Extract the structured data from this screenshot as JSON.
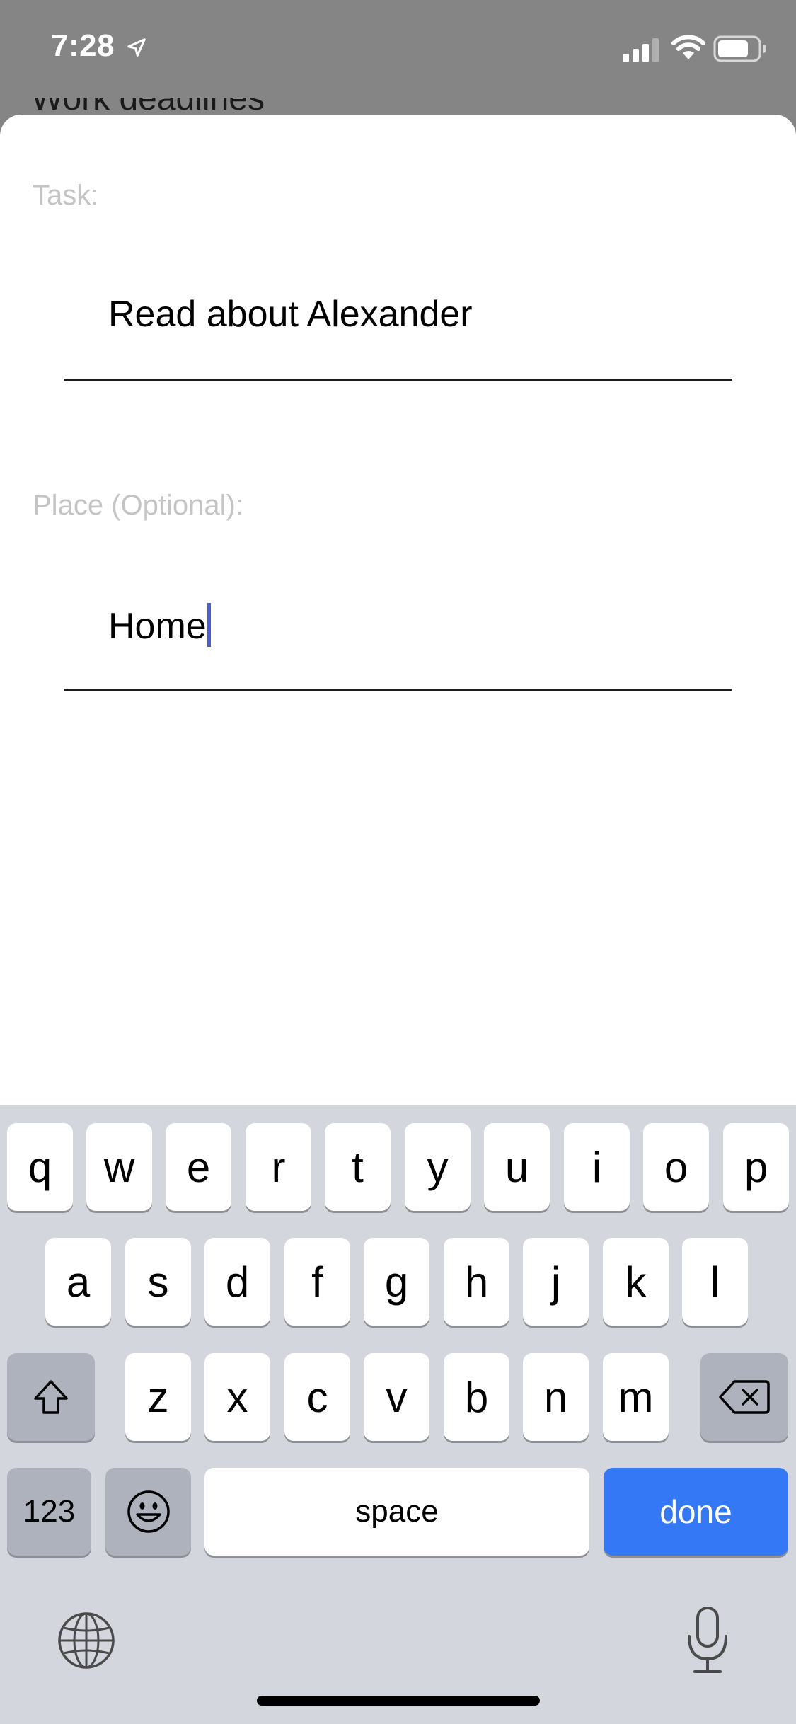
{
  "status_bar": {
    "time": "7:28",
    "icons": [
      "location-arrow-icon",
      "signal-icon",
      "wifi-icon",
      "battery-icon"
    ]
  },
  "background": {
    "title_peek": "Work deadlines"
  },
  "form": {
    "task": {
      "label": "Task:",
      "value": "Read about Alexander"
    },
    "place": {
      "label": "Place (Optional):",
      "value": "Home"
    },
    "cursor_color": "#4d5bd6"
  },
  "keyboard": {
    "row1": [
      "q",
      "w",
      "e",
      "r",
      "t",
      "y",
      "u",
      "i",
      "o",
      "p"
    ],
    "row2": [
      "a",
      "s",
      "d",
      "f",
      "g",
      "h",
      "j",
      "k",
      "l"
    ],
    "row3": [
      "z",
      "x",
      "c",
      "v",
      "b",
      "n",
      "m"
    ],
    "numbers_label": "123",
    "space_label": "space",
    "done_label": "done",
    "done_color": "#3478f6"
  }
}
